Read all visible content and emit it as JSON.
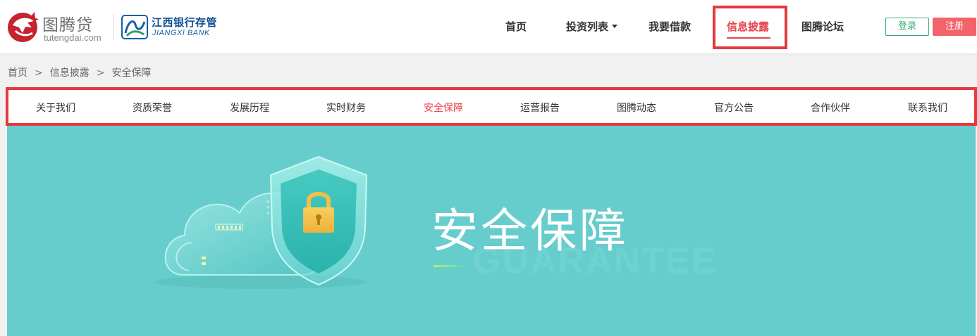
{
  "header": {
    "brand_name": "图腾贷",
    "brand_domain": "tutengdai.com",
    "bank_name": "江西银行存管",
    "bank_name_en": "JIANGXI BANK",
    "nav": [
      {
        "label": "首页"
      },
      {
        "label": "投资列表"
      },
      {
        "label": "我要借款"
      },
      {
        "label": "信息披露",
        "active": true
      },
      {
        "label": "图腾论坛"
      }
    ],
    "login_label": "登录",
    "register_label": "注册"
  },
  "breadcrumb": [
    "首页",
    "信息披露",
    "安全保障"
  ],
  "breadcrumb_sep": ">",
  "subnav": [
    {
      "label": "关于我们"
    },
    {
      "label": "资质荣誉"
    },
    {
      "label": "发展历程"
    },
    {
      "label": "实时财务"
    },
    {
      "label": "安全保障",
      "active": true
    },
    {
      "label": "运营报告"
    },
    {
      "label": "图腾动态"
    },
    {
      "label": "官方公告"
    },
    {
      "label": "合作伙伴"
    },
    {
      "label": "联系我们"
    }
  ],
  "banner": {
    "title": "安全保障",
    "subtitle": "GUARANTEE"
  },
  "colors": {
    "accent_red": "#e8444e",
    "highlight_box": "#e23a3f",
    "login_green": "#3aa97a",
    "register_red": "#f2646a",
    "banner_bg": "#67cdcc"
  },
  "icons": {
    "brand": "tuteng-logo-icon",
    "bank": "jiangxi-bank-logo-icon",
    "caret": "caret-down-icon",
    "banner": "cloud-shield-lock-illustration"
  }
}
